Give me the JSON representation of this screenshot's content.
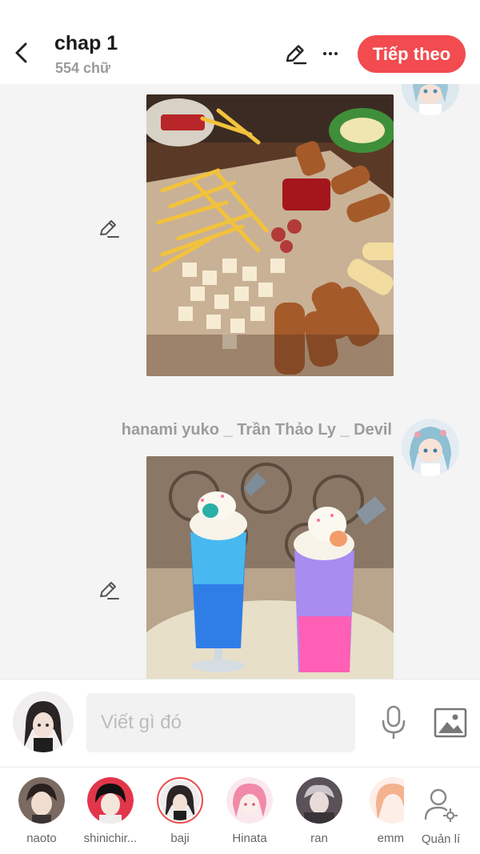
{
  "header": {
    "title": "chap 1",
    "subtitle": "554 chữ",
    "next_label": "Tiếp theo"
  },
  "chat": {
    "messages": [
      {
        "sender": "",
        "image": "fries-and-sausages-platter"
      },
      {
        "sender": "hanami yuko _ Trần Thảo Ly _ Devil",
        "image": "blue-and-pink-sundae-drinks"
      }
    ]
  },
  "composer": {
    "placeholder": "Viết gì đó"
  },
  "members": [
    {
      "name": "naoto"
    },
    {
      "name": "shinichir..."
    },
    {
      "name": "baji"
    },
    {
      "name": "Hinata"
    },
    {
      "name": "ran"
    },
    {
      "name": "emm"
    }
  ],
  "manage_label": "Quản lí",
  "colors": {
    "accent": "#f24b50",
    "chat_bg": "#f4f4f4"
  }
}
